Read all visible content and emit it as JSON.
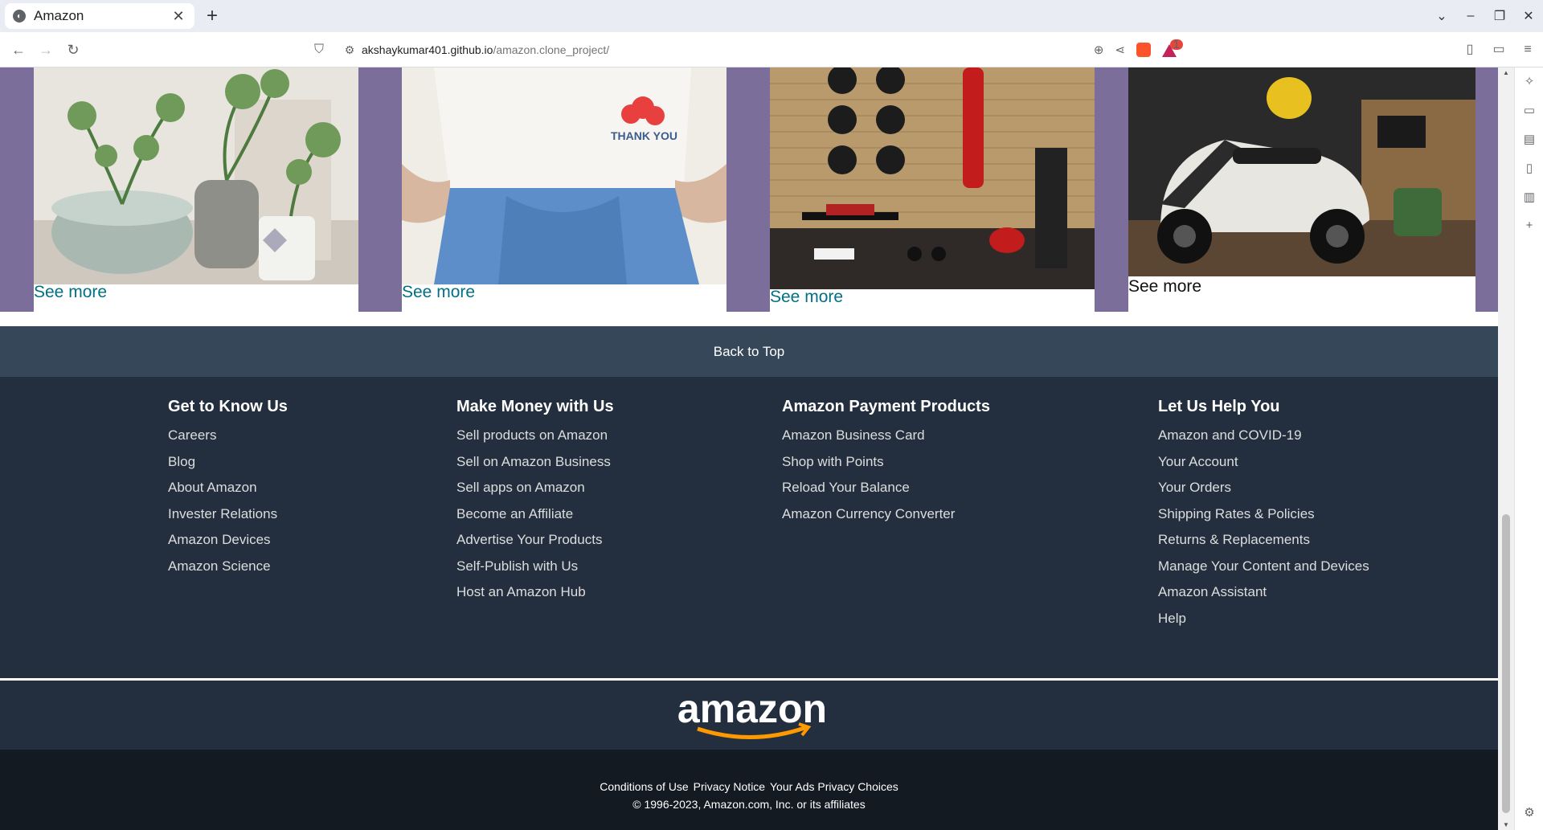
{
  "browser": {
    "tab_title": "Amazon",
    "url_host": "akshaykumar401.github.io",
    "url_path": "/amazon.clone_project/",
    "rewards_count": "1"
  },
  "cards": [
    {
      "image": "succulent plants in pots",
      "link": "See more",
      "link_color": "teal"
    },
    {
      "image": "woman in white thank-you t-shirt and blue skirt",
      "link": "See more",
      "link_color": "teal"
    },
    {
      "image": "home gym with weights and punching bag",
      "link": "See more",
      "link_color": "teal"
    },
    {
      "image": "electric scooter with yellow helmet",
      "link": "See more",
      "link_color": "black"
    }
  ],
  "footer": {
    "back_to_top": "Back to Top",
    "columns": [
      {
        "title": "Get to Know Us",
        "links": [
          "Careers",
          "Blog",
          "About Amazon",
          "Invester Relations",
          "Amazon Devices",
          "Amazon Science"
        ]
      },
      {
        "title": "Make Money with Us",
        "links": [
          "Sell products on Amazon",
          "Sell on Amazon Business",
          "Sell apps on Amazon",
          "Become an Affiliate",
          "Advertise Your Products",
          "Self-Publish with Us",
          "Host an Amazon Hub"
        ]
      },
      {
        "title": "Amazon Payment Products",
        "links": [
          "Amazon Business Card",
          "Shop with Points",
          "Reload Your Balance",
          "Amazon Currency Converter"
        ]
      },
      {
        "title": "Let Us Help You",
        "links": [
          "Amazon and COVID-19",
          "Your Account",
          "Your Orders",
          "Shipping Rates & Policies",
          "Returns & Replacements",
          "Manage Your Content and Devices",
          "Amazon Assistant",
          "Help"
        ]
      }
    ],
    "logo_text": "amazon",
    "bottom_links": [
      "Conditions of Use",
      "Privacy Notice",
      "Your Ads Privacy Choices"
    ],
    "copyright": "© 1996-2023, Amazon.com, Inc. or its affiliates"
  },
  "colors": {
    "band": "#7c6e9a",
    "link_teal": "#007185",
    "footer_dark": "#232f3e",
    "back_to_top": "#37475a",
    "bottom": "#131a22",
    "logo_orange": "#ff9900"
  }
}
